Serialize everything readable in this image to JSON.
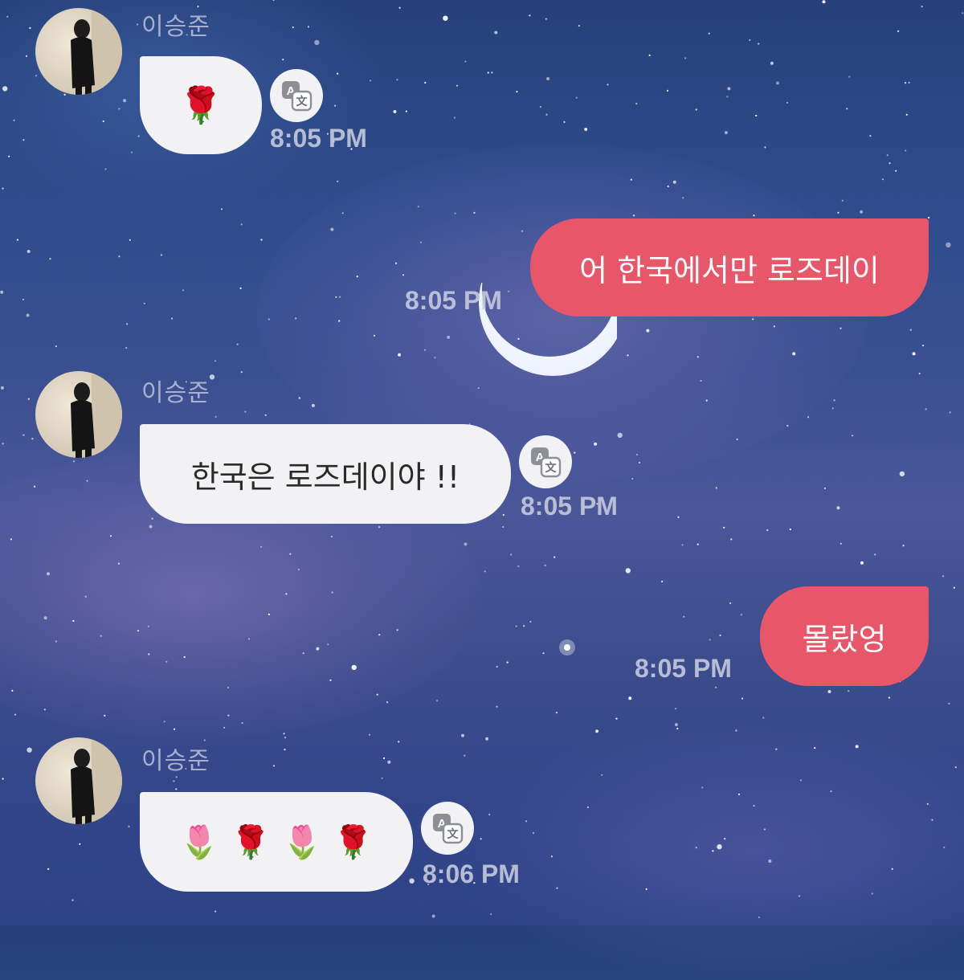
{
  "chat": {
    "messages": [
      {
        "direction": "incoming",
        "sender": "이승준",
        "content": "🌹",
        "content_type": "emoji",
        "time": "8:05 PM",
        "translate_icon": "translate-icon"
      },
      {
        "direction": "outgoing",
        "content": "어 한국에서만 로즈데이",
        "content_type": "text",
        "time": "8:05 PM"
      },
      {
        "direction": "incoming",
        "sender": "이승준",
        "content": "한국은 로즈데이야 !!",
        "content_type": "text",
        "time": "8:05 PM",
        "translate_icon": "translate-icon"
      },
      {
        "direction": "outgoing",
        "content": "몰랐엉",
        "content_type": "text",
        "time": "8:05 PM"
      },
      {
        "direction": "incoming",
        "sender": "이승준",
        "content": [
          "🌷",
          "🌹",
          "🌷",
          "🌹"
        ],
        "content_type": "emoji",
        "time": "8:06 PM",
        "translate_icon": "translate-icon"
      }
    ]
  },
  "colors": {
    "incoming_bubble": "#f2f2f4",
    "outgoing_bubble": "#e8566a",
    "timestamp": "#c8cdde",
    "background": "#2f4c8c"
  }
}
